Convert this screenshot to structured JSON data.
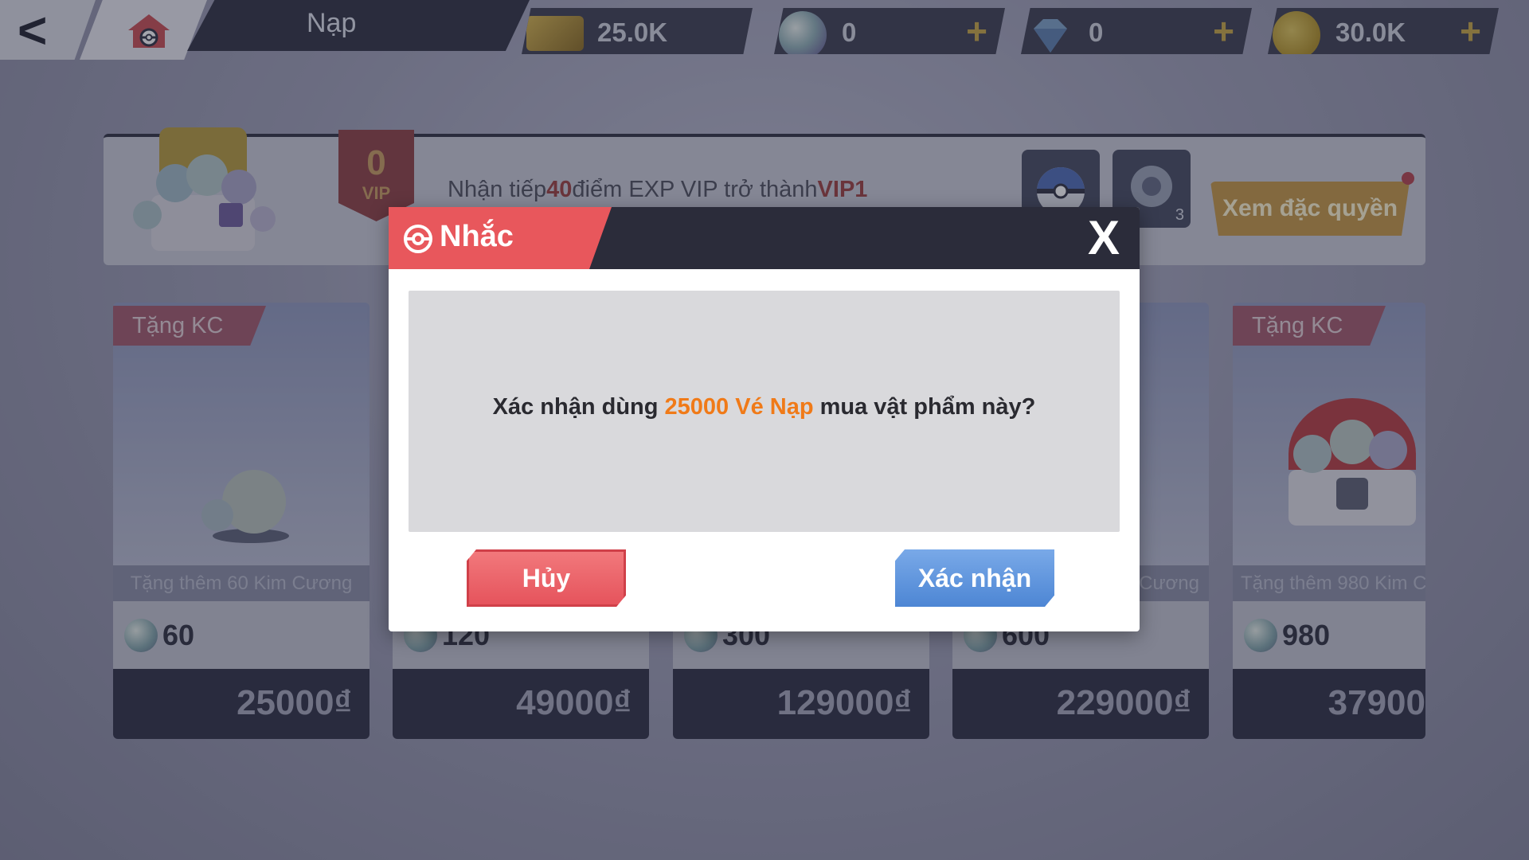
{
  "header": {
    "title": "Nạp",
    "resources": [
      {
        "icon": "ticket-icon",
        "value": "25.0K",
        "has_plus": false
      },
      {
        "icon": "rainbow-gem-icon",
        "value": "0",
        "has_plus": true
      },
      {
        "icon": "diamond-icon",
        "value": "0",
        "has_plus": true
      },
      {
        "icon": "gold-coin-icon",
        "value": "30.0K",
        "has_plus": true
      }
    ],
    "plus_symbol": "+"
  },
  "vip": {
    "level": "0",
    "label": "VIP",
    "text_prefix": "Nhận tiếp",
    "points": "40",
    "text_middle": "điểm EXP VIP trở thành",
    "next_level": "VIP1",
    "item_count": "3",
    "button_label": "Xem đặc quyền"
  },
  "cards": [
    {
      "tag": "Tặng KC",
      "desc": "Tặng thêm 60 Kim Cương",
      "amount": "60",
      "price": "25000₫"
    },
    {
      "tag": "",
      "desc": "",
      "amount": "120",
      "price": "49000₫"
    },
    {
      "tag": "",
      "desc": "",
      "amount": "300",
      "price": "129000₫"
    },
    {
      "tag": "",
      "desc": "Cương",
      "amount": "600",
      "price": "229000₫"
    },
    {
      "tag": "Tặng KC",
      "desc": "Tặng thêm 980 Kim C",
      "amount": "980",
      "price": "37900"
    }
  ],
  "modal": {
    "title": "Nhắc",
    "close_label": "X",
    "message_prefix": "Xác nhận dùng ",
    "message_highlight": "25000 Vé Nạp",
    "message_suffix": " mua vật phẩm này?",
    "cancel_label": "Hủy",
    "confirm_label": "Xác nhận"
  },
  "colors": {
    "accent_red": "#e8575c",
    "accent_blue": "#4d86d4",
    "highlight_orange": "#f07a18",
    "header_dark": "#2b2c3a"
  }
}
